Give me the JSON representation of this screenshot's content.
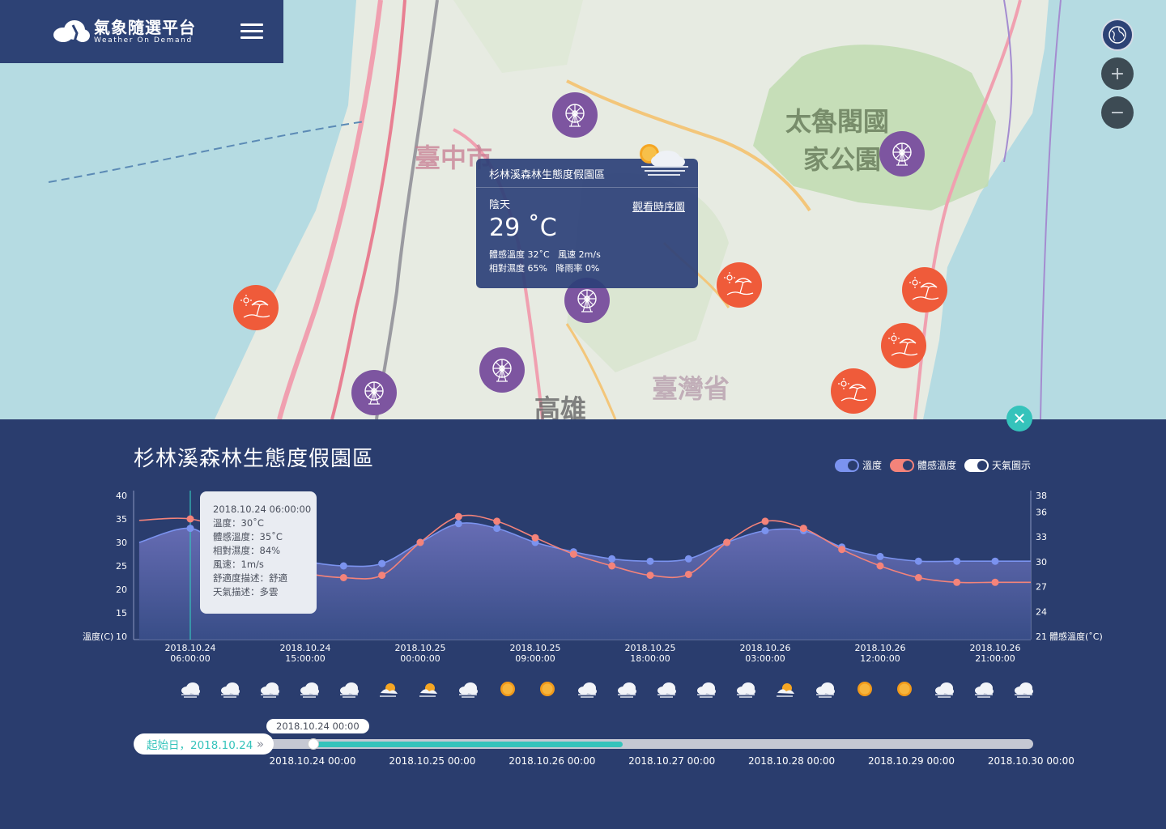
{
  "brand": {
    "name": "氣象隨選平台",
    "sub": "Weather On Demand"
  },
  "map": {
    "labels": {
      "city": "臺中市",
      "park": "太魯閣國",
      "park2": "家公園",
      "province": "臺灣省",
      "city2": "高雄"
    },
    "controls": {
      "zoom_in": "+",
      "zoom_out": "−"
    }
  },
  "popup": {
    "title": "杉林溪森林生態度假園區",
    "condition": "陰天",
    "link": "觀看時序圖",
    "temp": "29 ˚C",
    "details": "體感溫度 32˚C   風速 2m/s\n相對濕度 65%   降雨率 0%"
  },
  "panel": {
    "title": "杉林溪森林生態度假園區",
    "close": "✕",
    "legend": [
      {
        "label": "溫度",
        "color": "#7b93ef"
      },
      {
        "label": "體感溫度",
        "color": "#f4837a"
      },
      {
        "label": "天氣圖示",
        "color": "#ffffff"
      }
    ]
  },
  "tooltip": {
    "time": "2018.10.24 06:00:00",
    "temp": "溫度：30˚C",
    "feel": "體感溫度：35˚C",
    "humidity": "相對濕度：84%",
    "wind": "風速：1m/s",
    "comfort": "舒適度描述：舒適",
    "weather": "天氣描述：多雲"
  },
  "chart_data": {
    "type": "line",
    "title": "",
    "ylabel": "溫度(C)",
    "y2label": "體感溫度(˚C)",
    "ylim": [
      10,
      40
    ],
    "y2lim": [
      21,
      38
    ],
    "yticks": [
      10,
      15,
      20,
      25,
      30,
      35,
      40
    ],
    "y2ticks": [
      21,
      24,
      27,
      30,
      33,
      36,
      38
    ],
    "x_ticks": [
      [
        "2018.10.24",
        "06:00:00"
      ],
      [
        "2018.10.24",
        "15:00:00"
      ],
      [
        "2018.10.25",
        "00:00:00"
      ],
      [
        "2018.10.25",
        "09:00:00"
      ],
      [
        "2018.10.25",
        "18:00:00"
      ],
      [
        "2018.10.26",
        "03:00:00"
      ],
      [
        "2018.10.26",
        "12:00:00"
      ],
      [
        "2018.10.26",
        "21:00:00"
      ]
    ],
    "x_hours": [
      0,
      9,
      18,
      27,
      36,
      45,
      54,
      63
    ],
    "series": [
      {
        "name": "溫度",
        "color": "#7b93ef",
        "x": [
          -4,
          0,
          3,
          6,
          9,
          12,
          15,
          18,
          21,
          24,
          27,
          30,
          33,
          36,
          39,
          42,
          45,
          48,
          51,
          54,
          57,
          60,
          63,
          66
        ],
        "values": [
          30,
          33,
          28,
          28,
          26,
          25,
          25.5,
          30,
          34,
          33,
          30,
          28,
          26.5,
          26,
          26.5,
          30,
          32.5,
          32.5,
          29,
          27,
          26,
          26,
          26,
          26
        ]
      },
      {
        "name": "體感溫度",
        "color": "#f4837a",
        "x": [
          -4,
          0,
          3,
          6,
          9,
          12,
          15,
          18,
          21,
          24,
          27,
          30,
          33,
          36,
          39,
          42,
          45,
          48,
          51,
          54,
          57,
          60,
          63,
          66
        ],
        "values": [
          34.7,
          35,
          32,
          26,
          23.5,
          22.5,
          23,
          30,
          35.5,
          34.5,
          31,
          27.5,
          25,
          23,
          23.2,
          30,
          34.5,
          33,
          28.5,
          25,
          22.5,
          21.5,
          21.5,
          21.5
        ]
      }
    ],
    "marker_x": 0,
    "grid": false,
    "legend": "top-right"
  },
  "weather_icons": [
    "cloudy",
    "cloudy",
    "cloudy",
    "cloudy",
    "cloudy",
    "partly",
    "partly",
    "cloudy",
    "sunny",
    "sunny",
    "cloudy",
    "cloudy",
    "cloudy",
    "cloudy",
    "cloudy",
    "partly",
    "cloudy",
    "sunny",
    "sunny",
    "cloudy",
    "cloudy",
    "cloudy"
  ],
  "timeline": {
    "start_label": "起始日，2018.10.24",
    "chevron": "»",
    "thumb_label": "2018.10.24 00:00",
    "ticks": [
      "2018.10.24 00:00",
      "2018.10.25 00:00",
      "2018.10.26 00:00",
      "2018.10.27 00:00",
      "2018.10.28 00:00",
      "2018.10.29 00:00",
      "2018.10.30 00:00"
    ],
    "progress": 0.43
  }
}
